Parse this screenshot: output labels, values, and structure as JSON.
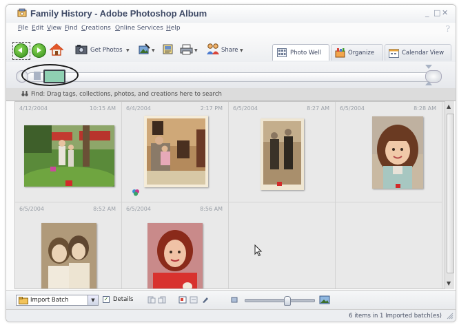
{
  "window": {
    "title": "Family History - Adobe Photoshop Album",
    "controls": {
      "minimize": "_",
      "restore": "□",
      "close": "✕"
    }
  },
  "menu": {
    "items": [
      "File",
      "Edit",
      "View",
      "Find",
      "Creations",
      "Online Services",
      "Help"
    ],
    "help_icon": "?"
  },
  "toolbar": {
    "back_icon": "back-arrow-icon",
    "forward_icon": "forward-arrow-icon",
    "home_icon": "home-icon",
    "get_photos_label": "Get Photos",
    "share_label": "Share",
    "tabs": [
      "Photo Well",
      "Organize",
      "Calendar View"
    ],
    "active_tab": "Photo Well"
  },
  "find_bar": {
    "text": "Find: Drag tags, collections, photos, and creations here to search"
  },
  "photos": [
    {
      "date": "4/12/2004",
      "time": "10:15 AM"
    },
    {
      "date": "6/4/2004",
      "time": "2:17 PM"
    },
    {
      "date": "6/5/2004",
      "time": "8:27 AM"
    },
    {
      "date": "6/5/2004",
      "time": "8:28 AM"
    },
    {
      "date": "6/5/2004",
      "time": "8:52 AM"
    },
    {
      "date": "6/5/2004",
      "time": "8:56 AM"
    }
  ],
  "bottom_bar": {
    "arrange_value": "Import Batch",
    "details_label": "Details",
    "details_checked": true,
    "thumbnail_size_fraction": 0.6
  },
  "status": {
    "text": "6 items in 1 Imported batch(es)"
  },
  "colors": {
    "title_text": "#3f4a66",
    "accent_green": "#3a9a1f",
    "grid_bg": "#e9e9e9"
  }
}
